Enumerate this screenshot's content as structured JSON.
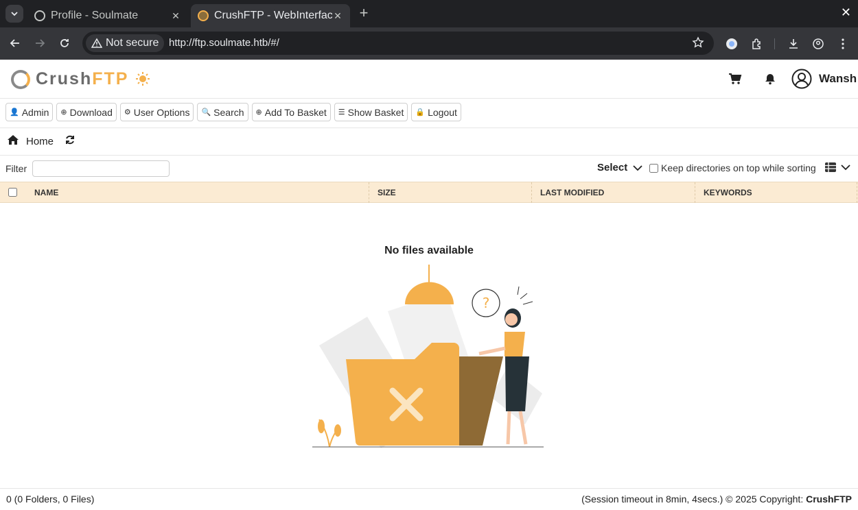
{
  "browser": {
    "tabs": [
      {
        "title": "Profile - Soulmate",
        "active": false
      },
      {
        "title": "CrushFTP - WebInterface",
        "active": true
      }
    ],
    "security_label": "Not secure",
    "url": "http://ftp.soulmate.htb/#/"
  },
  "header": {
    "logo_main": "Crush",
    "logo_accent": "FTP",
    "username": "Wansh"
  },
  "toolbar_buttons": [
    {
      "label": "Admin",
      "icon": "user-icon"
    },
    {
      "label": "Download",
      "icon": "download-icon"
    },
    {
      "label": "User Options",
      "icon": "gear-icon"
    },
    {
      "label": "Search",
      "icon": "search-icon"
    },
    {
      "label": "Add To Basket",
      "icon": "plus-circle-icon"
    },
    {
      "label": "Show Basket",
      "icon": "list-icon"
    },
    {
      "label": "Logout",
      "icon": "lock-icon"
    }
  ],
  "breadcrumb": {
    "home": "Home"
  },
  "filter": {
    "label": "Filter",
    "value": ""
  },
  "select_label": "Select",
  "keep_dirs_label": "Keep directories on top while sorting",
  "columns": [
    "NAME",
    "SIZE",
    "LAST MODIFIED",
    "KEYWORDS"
  ],
  "empty_message": "No files available",
  "footer": {
    "count": "0 (0 Folders, 0 Files)",
    "session": "(Session timeout in 8min, 4secs.) © 2025 Copyright: ",
    "brand": "CrushFTP"
  },
  "colors": {
    "accent": "#f4b04c",
    "header_bg": "#fbebd3"
  }
}
